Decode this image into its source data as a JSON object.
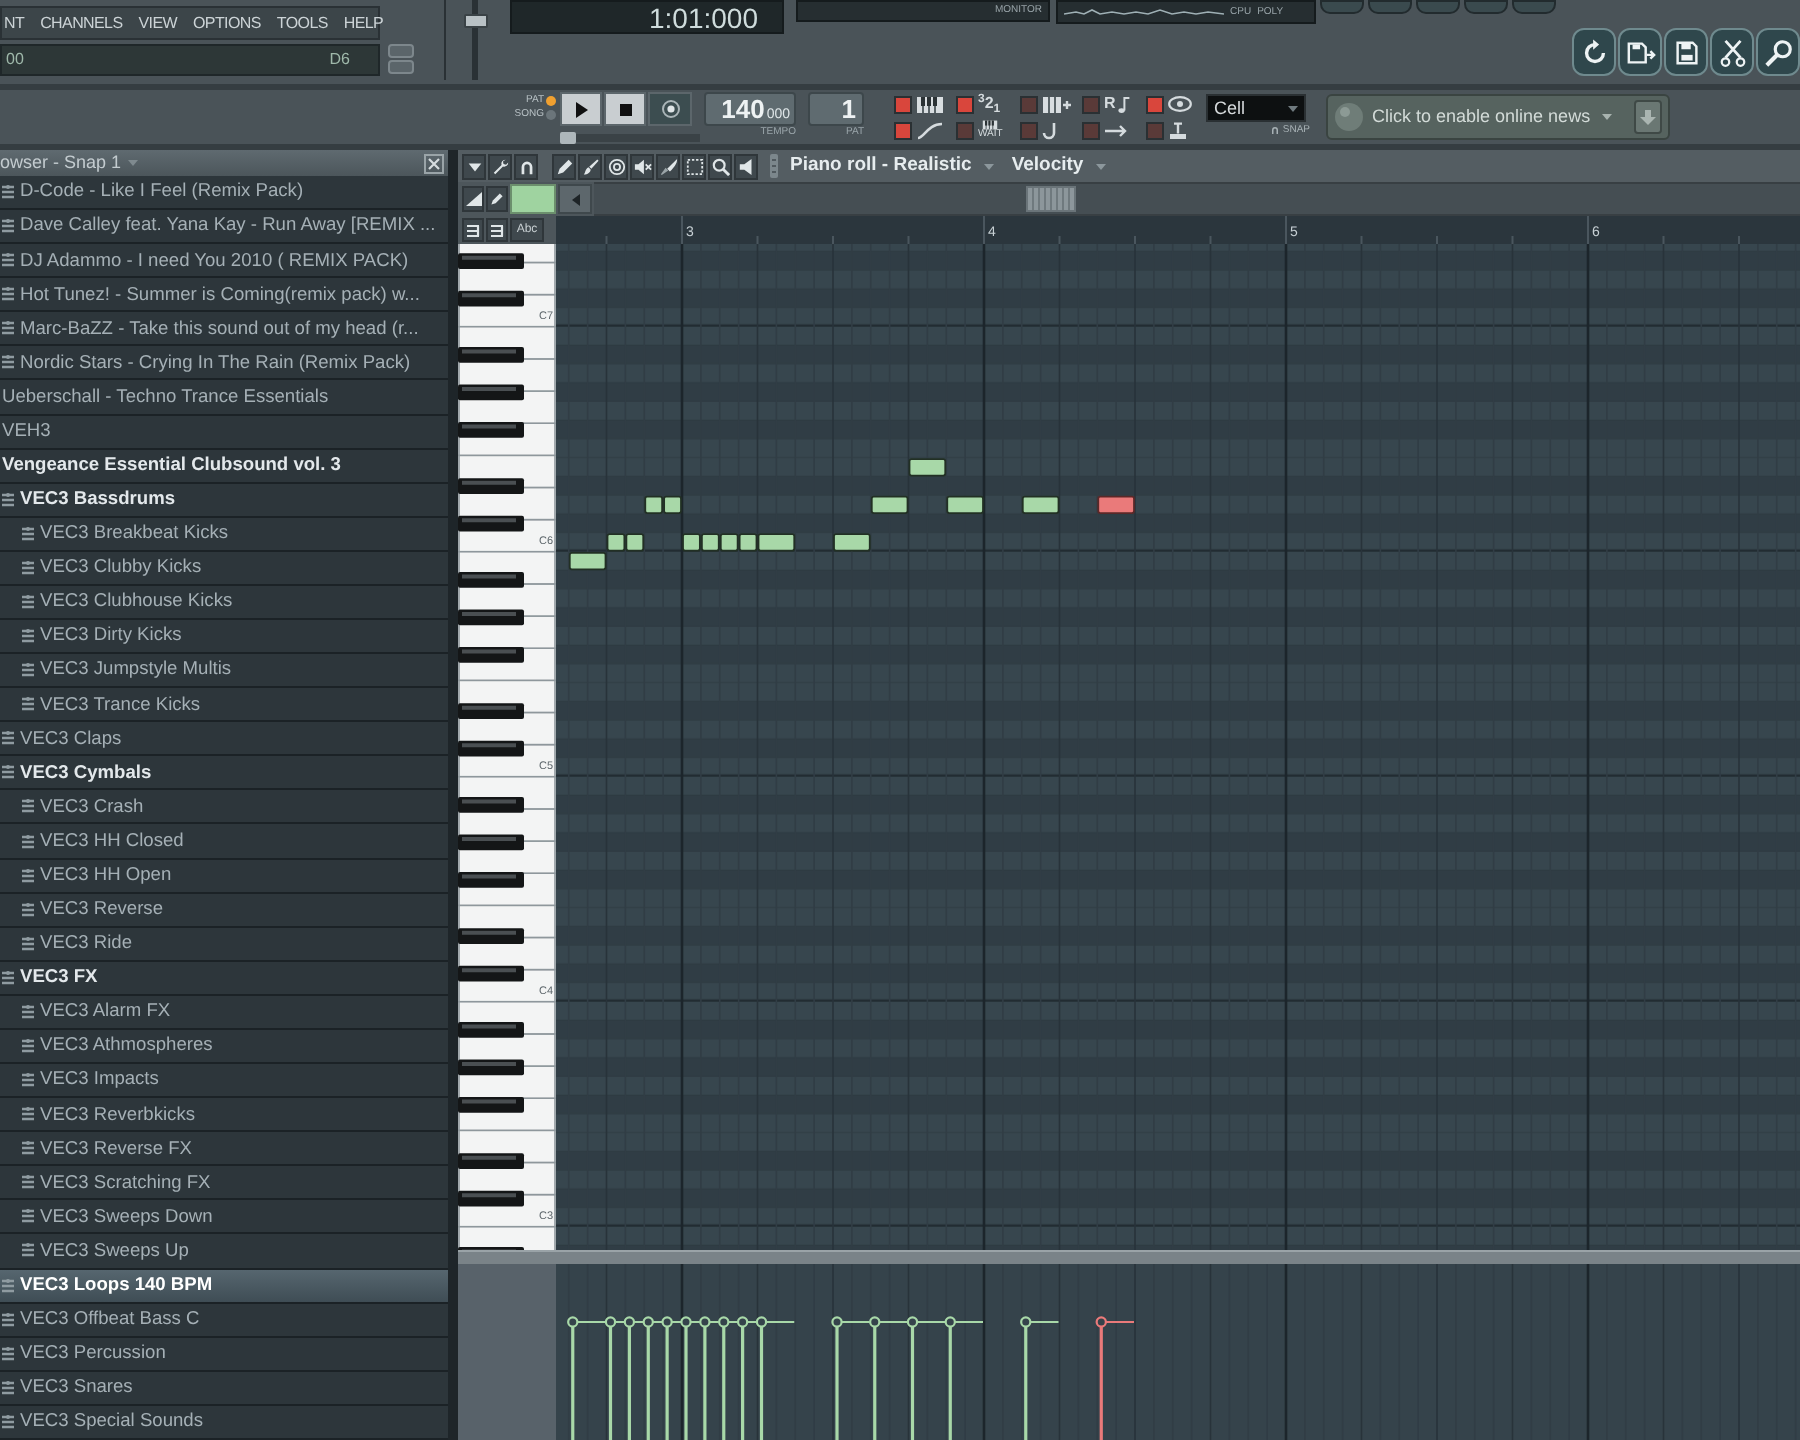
{
  "menu": {
    "items": [
      "NT",
      "CHANNELS",
      "VIEW",
      "OPTIONS",
      "TOOLS",
      "HELP"
    ]
  },
  "hint_bar": {
    "text": "00",
    "note": "D6"
  },
  "master_volume": {
    "level": 0.8
  },
  "displays": {
    "time": "1:01:000",
    "monitor_label": "MONITOR",
    "cpu_label": "CPU",
    "poly_label": "POLY"
  },
  "transport": {
    "modes": [
      {
        "label": "PAT",
        "selected": true
      },
      {
        "label": "SONG",
        "selected": false
      }
    ],
    "position": {
      "level": 0
    },
    "tempo": {
      "value": "140",
      "fraction": "000",
      "label": "TEMPO"
    },
    "pattern": {
      "value": "1",
      "label": "PAT"
    }
  },
  "toggles": [
    {
      "on": true
    },
    {
      "on": true,
      "label": "$^{3}$2$_{1}$"
    },
    {
      "on": false
    },
    {
      "on": false,
      "label": "R"
    },
    {
      "on": true
    },
    {
      "on": true
    },
    {
      "on": false,
      "label": "WAIT"
    },
    {
      "on": false
    },
    {
      "on": false
    },
    {
      "on": false
    }
  ],
  "snap": {
    "value": "Cell",
    "label": "SNAP"
  },
  "news": {
    "text": "Click to enable online news"
  },
  "browser": {
    "title": "owser - Snap 1",
    "tree": [
      {
        "children": [
          {
            "label": "D-Code - Like I Feel (Remix Pack)",
            "expanded": false,
            "selected": false
          },
          {
            "label": "Dave Calley feat. Yana Kay - Run Away [REMIX ...",
            "expanded": false,
            "selected": false
          },
          {
            "label": "DJ Adammo - I need You 2010 ( REMIX PACK)",
            "expanded": false,
            "selected": false
          },
          {
            "label": "Hot Tunez! - Summer is Coming(remix pack) w...",
            "expanded": false,
            "selected": false
          },
          {
            "label": "Marc-BaZZ - Take this sound out of my head (r...",
            "expanded": false,
            "selected": false
          },
          {
            "label": "Nordic Stars - Crying In The Rain (Remix Pack)",
            "expanded": false,
            "selected": false
          }
        ]
      },
      {
        "label": "Ueberschall - Techno Trance Essentials",
        "expanded": false,
        "selected": false
      },
      {
        "label": "VEH3",
        "expanded": false,
        "selected": false
      },
      {
        "label": "Vengeance Essential Clubsound vol. 3",
        "expanded": true,
        "selected": false,
        "children": [
          {
            "label": "VEC3 Bassdrums",
            "expanded": true,
            "selected": false,
            "children": [
              {
                "label": "VEC3 Breakbeat Kicks",
                "expanded": false,
                "selected": false
              },
              {
                "label": "VEC3 Clubby Kicks",
                "expanded": false,
                "selected": false
              },
              {
                "label": "VEC3 Clubhouse Kicks",
                "expanded": false,
                "selected": false
              },
              {
                "label": "VEC3 Dirty Kicks",
                "expanded": false,
                "selected": false
              },
              {
                "label": "VEC3 Jumpstyle Multis",
                "expanded": false,
                "selected": false
              },
              {
                "label": "VEC3 Trance Kicks",
                "expanded": false,
                "selected": false
              }
            ]
          },
          {
            "label": "VEC3 Claps",
            "expanded": false,
            "selected": false
          },
          {
            "label": "VEC3 Cymbals",
            "expanded": true,
            "selected": false,
            "children": [
              {
                "label": "VEC3 Crash",
                "expanded": false,
                "selected": false
              },
              {
                "label": "VEC3 HH Closed",
                "expanded": false,
                "selected": false
              },
              {
                "label": "VEC3 HH Open",
                "expanded": false,
                "selected": false
              },
              {
                "label": "VEC3 Reverse",
                "expanded": false,
                "selected": false
              },
              {
                "label": "VEC3 Ride",
                "expanded": false,
                "selected": false
              }
            ]
          },
          {
            "label": "VEC3 FX",
            "expanded": true,
            "selected": false,
            "children": [
              {
                "label": "VEC3 Alarm FX",
                "expanded": false,
                "selected": false
              },
              {
                "label": "VEC3 Athmospheres",
                "expanded": false,
                "selected": false
              },
              {
                "label": "VEC3 Impacts",
                "expanded": false,
                "selected": false
              },
              {
                "label": "VEC3 Reverbkicks",
                "expanded": false,
                "selected": false
              },
              {
                "label": "VEC3 Reverse FX",
                "expanded": false,
                "selected": false
              },
              {
                "label": "VEC3 Scratching FX",
                "expanded": false,
                "selected": false
              },
              {
                "label": "VEC3 Sweeps Down",
                "expanded": false,
                "selected": false
              },
              {
                "label": "VEC3 Sweeps Up",
                "expanded": false,
                "selected": false
              }
            ]
          },
          {
            "label": "VEC3 Loops 140 BPM",
            "expanded": false,
            "selected": true
          },
          {
            "label": "VEC3 Offbeat Bass C",
            "expanded": false,
            "selected": false
          },
          {
            "label": "VEC3 Percussion",
            "expanded": false,
            "selected": false
          },
          {
            "label": "VEC3 Snares",
            "expanded": false,
            "selected": false
          },
          {
            "label": "VEC3 Special Sounds",
            "expanded": false,
            "selected": false
          }
        ]
      }
    ]
  },
  "piano_roll": {
    "title": "Piano roll - Realistic",
    "target": "Velocity",
    "abc_button": "Abc",
    "bar_numbers": [
      "3",
      "4",
      "5",
      "6"
    ],
    "key_labels": [
      "C7",
      "C6",
      "C5",
      "C4",
      "C3"
    ]
  }
}
